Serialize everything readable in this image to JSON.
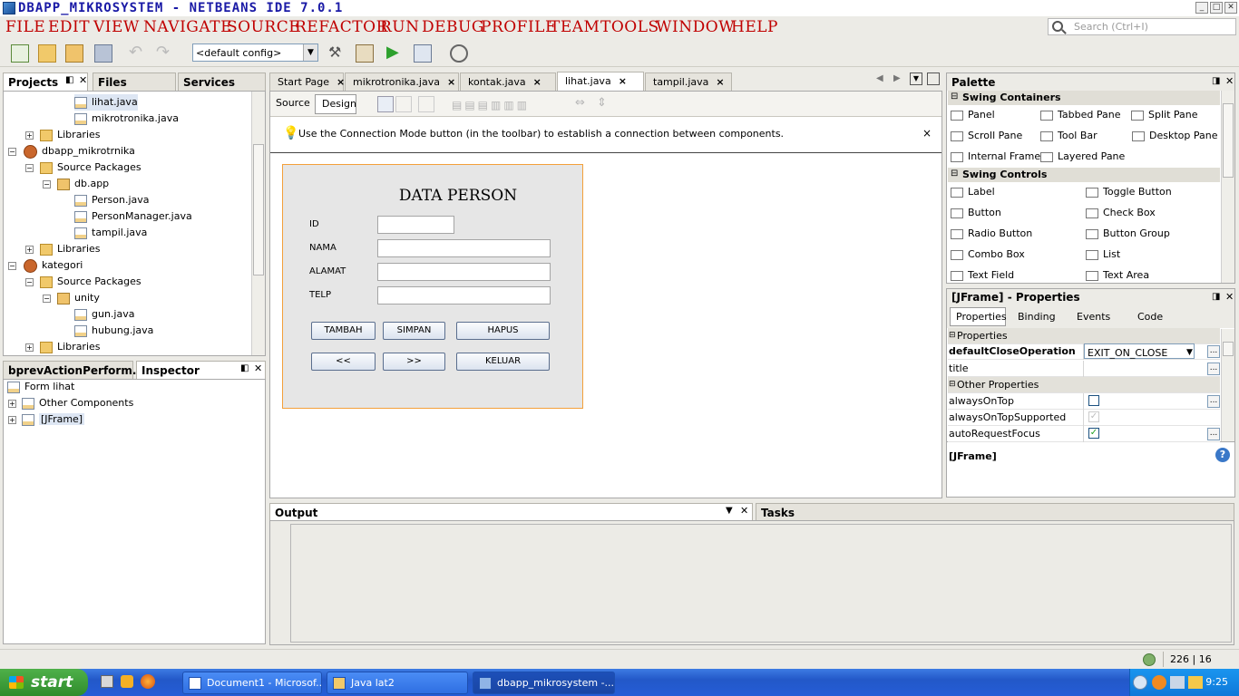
{
  "window": {
    "title": "DBAPP_MIKROSYSTEM - NETBEANS IDE 7.0.1"
  },
  "menu": [
    "File",
    "Edit",
    "View",
    "Navigate",
    "Source",
    "Refactor",
    "Run",
    "Debug",
    "Profile",
    "Team",
    "Tools",
    "Window",
    "Help"
  ],
  "search": {
    "placeholder": "Search (Ctrl+I)"
  },
  "toolbar": {
    "config": "<default config>"
  },
  "left_tabs": [
    "Projects",
    "Files",
    "Services"
  ],
  "tree": [
    {
      "label": "lihat.java",
      "selected": true
    },
    {
      "label": "mikrotronika.java"
    },
    {
      "label": "Libraries"
    },
    {
      "label": "dbapp_mikrotrnika"
    },
    {
      "label": "Source Packages"
    },
    {
      "label": "db.app"
    },
    {
      "label": "Person.java"
    },
    {
      "label": "PersonManager.java"
    },
    {
      "label": "tampil.java"
    },
    {
      "label": "Libraries"
    },
    {
      "label": "kategori"
    },
    {
      "label": "Source Packages"
    },
    {
      "label": "unity"
    },
    {
      "label": "gun.java"
    },
    {
      "label": "hubung.java"
    },
    {
      "label": "Libraries"
    }
  ],
  "nav_tabs": [
    "bprevActionPerform...",
    "Inspector"
  ],
  "inspector": [
    {
      "label": "Form lihat"
    },
    {
      "label": "Other Components"
    },
    {
      "label": "[JFrame]"
    }
  ],
  "editor_tabs": [
    "Start Page",
    "mikrotronika.java",
    "kontak.java",
    "lihat.java",
    "tampil.java"
  ],
  "editor_modes": [
    "Source",
    "Design"
  ],
  "hint": "Use the Connection Mode button (in the toolbar) to establish a connection between components.",
  "form": {
    "title": "DATA  PERSON",
    "labels": [
      "ID",
      "NAMA",
      "ALAMAT",
      "TELP"
    ],
    "buttons_row1": [
      "TAMBAH",
      "SIMPAN",
      "HAPUS"
    ],
    "buttons_row2": [
      "<<",
      ">>",
      "KELUAR"
    ]
  },
  "output": {
    "tabs": [
      "Output",
      "Tasks"
    ]
  },
  "palette": {
    "title": "Palette",
    "sections": [
      {
        "name": "Swing Containers",
        "items": [
          "Panel",
          "Tabbed Pane",
          "Split Pane",
          "Scroll Pane",
          "Tool Bar",
          "Desktop Pane",
          "Internal Frame",
          "Layered Pane"
        ]
      },
      {
        "name": "Swing Controls",
        "items": [
          "Label",
          "Toggle Button",
          "Button",
          "Check Box",
          "Radio Button",
          "Button Group",
          "Combo Box",
          "List",
          "Text Field",
          "Text Area"
        ]
      }
    ]
  },
  "properties": {
    "title": "[JFrame] - Properties",
    "tabs": [
      "Properties",
      "Binding",
      "Events",
      "Code"
    ],
    "group1": "Properties",
    "rows1": [
      {
        "key": "defaultCloseOperation",
        "value": "EXIT_ON_CLOSE"
      },
      {
        "key": "title",
        "value": ""
      }
    ],
    "group2": "Other Properties",
    "rows2": [
      {
        "key": "alwaysOnTop",
        "checked": false
      },
      {
        "key": "alwaysOnTopSupported",
        "checked": true
      },
      {
        "key": "autoRequestFocus",
        "checked": true
      }
    ],
    "footer": "[JFrame]"
  },
  "status": {
    "position": "226 | 16"
  },
  "taskbar": {
    "start": "start",
    "items": [
      "Document1 - Microsof...",
      "Java lat2",
      "dbapp_mikrosystem -..."
    ],
    "clock": "9:25"
  }
}
